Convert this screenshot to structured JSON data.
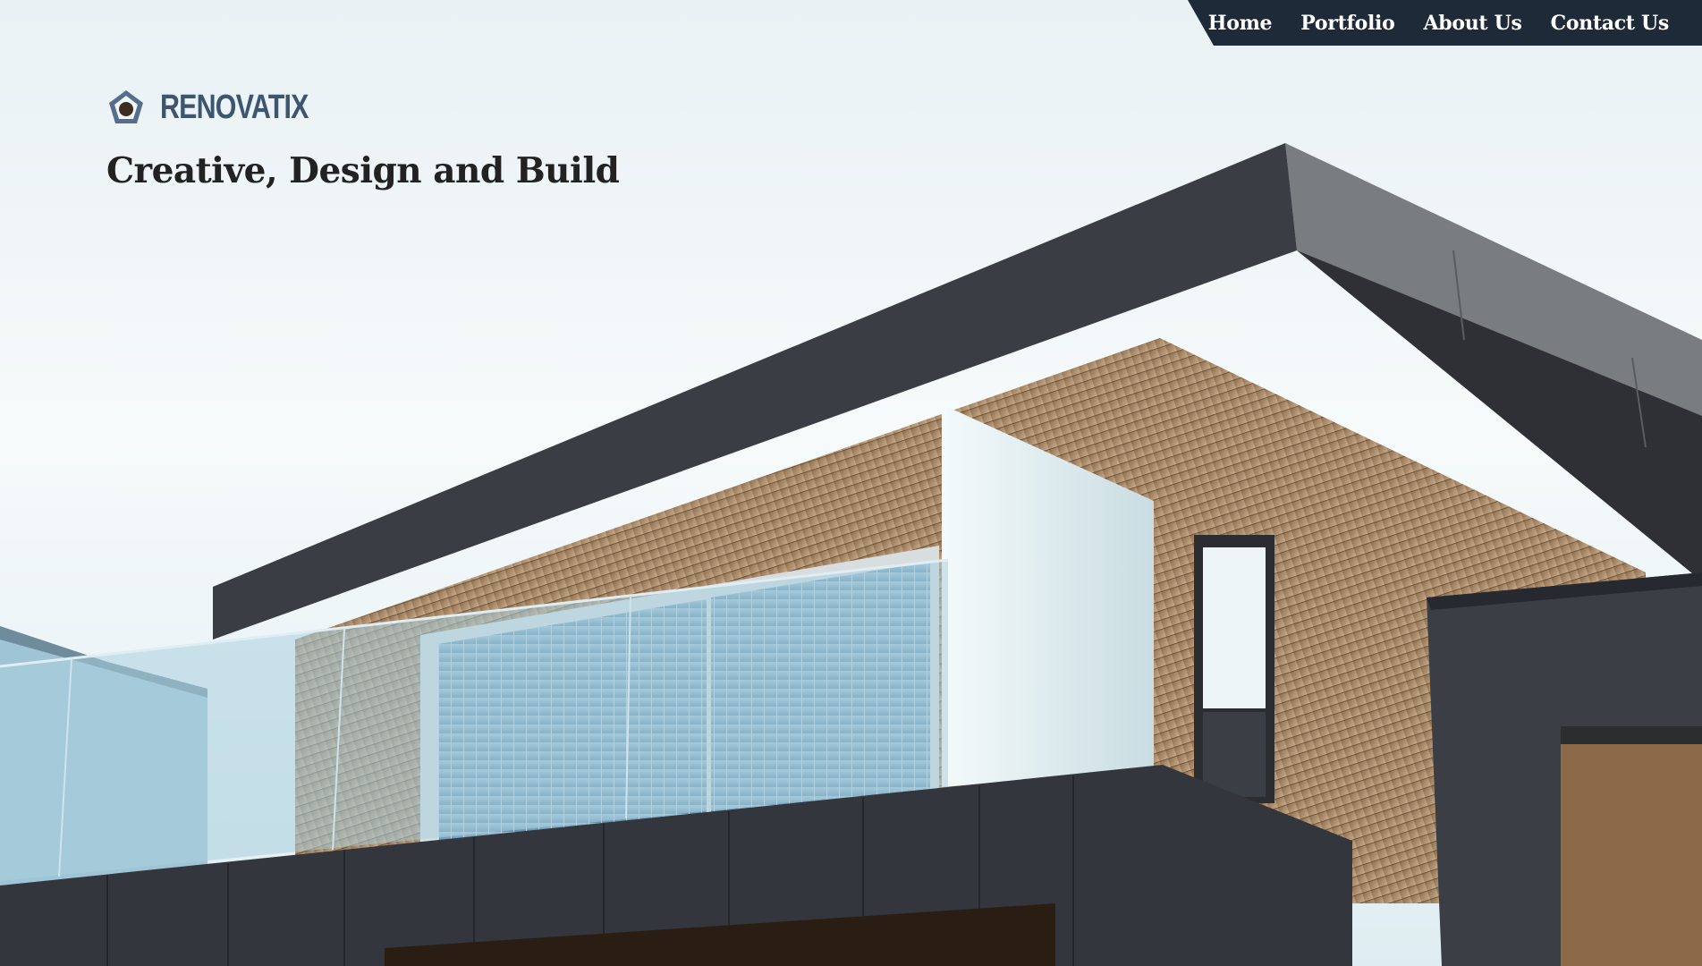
{
  "nav": {
    "items": [
      {
        "label": "Home"
      },
      {
        "label": "Portfolio"
      },
      {
        "label": "About Us"
      },
      {
        "label": "Contact Us"
      }
    ]
  },
  "brand": {
    "name": "RENOVATIX",
    "icon": "pentagon-logo-icon"
  },
  "hero": {
    "tagline": "Creative, Design and Build",
    "image": "modern-house-photo"
  },
  "colors": {
    "nav_background": "#1e2a38",
    "brand_text": "#3e5570",
    "tagline_text": "#222222"
  }
}
